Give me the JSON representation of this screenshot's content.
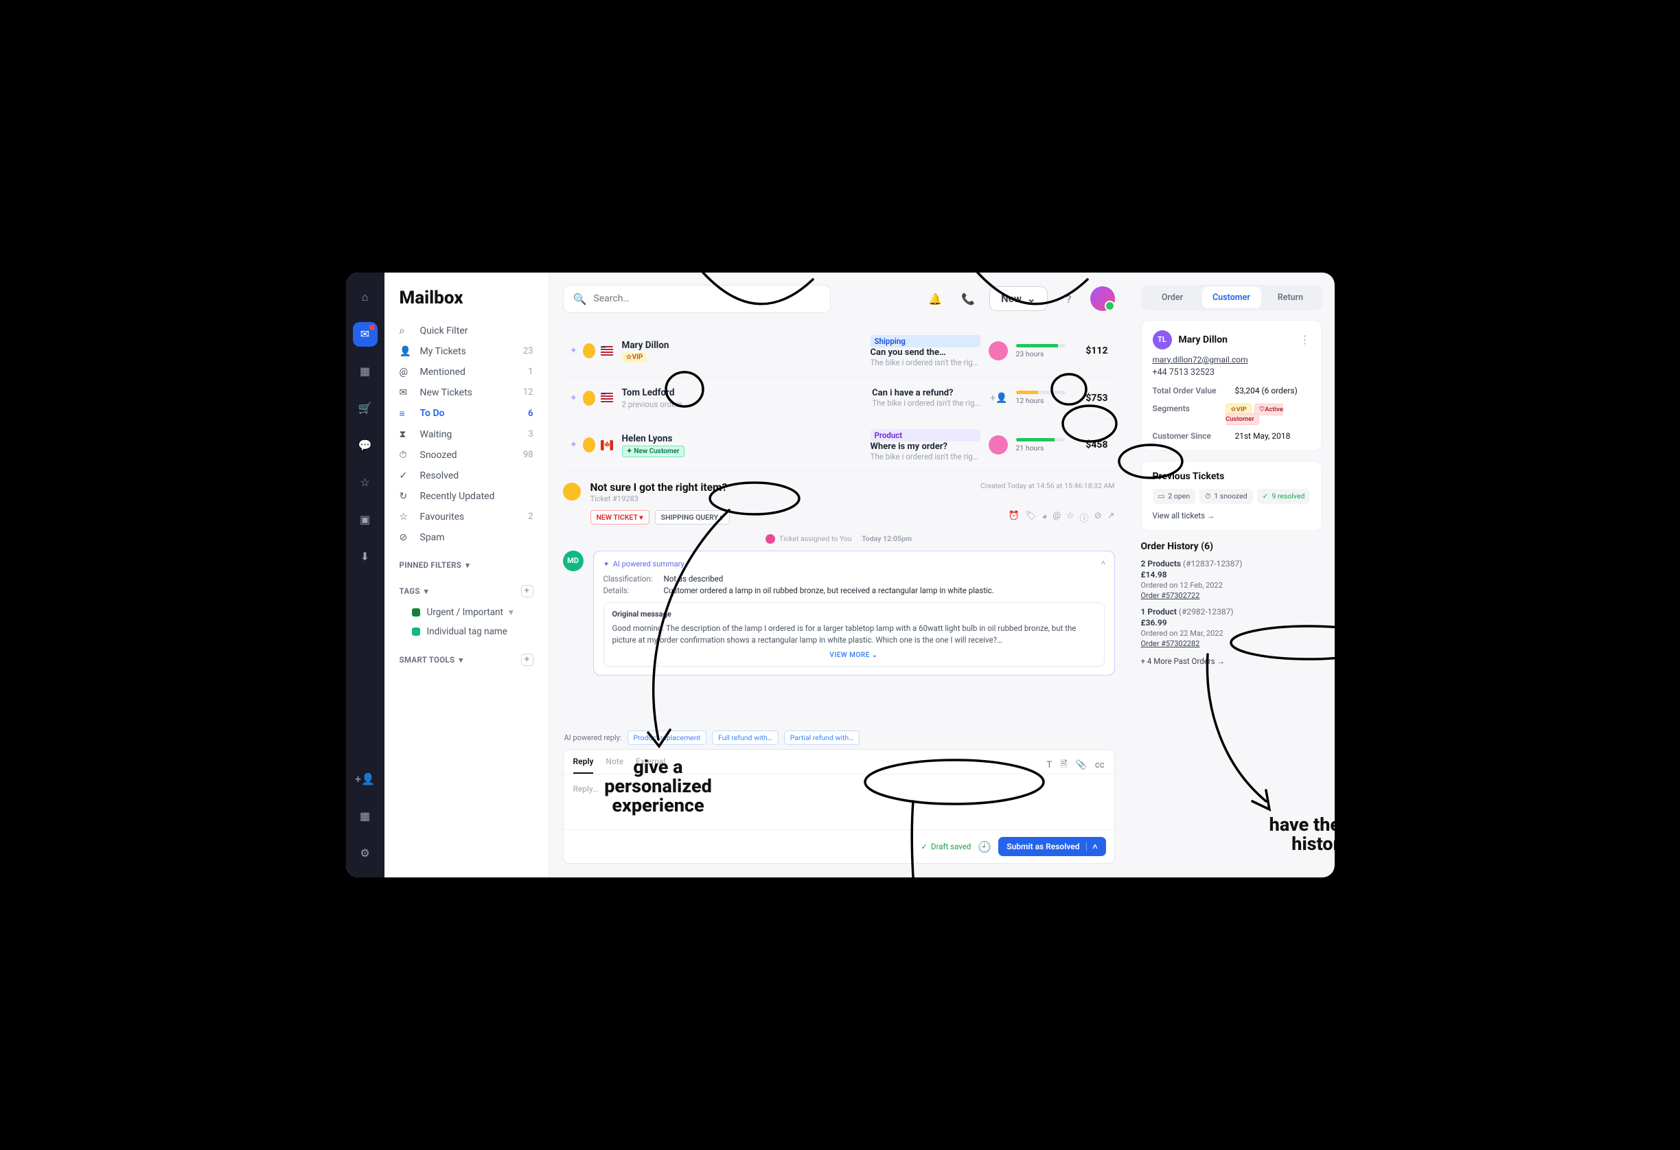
{
  "sidebar": {
    "title": "Mailbox",
    "items": [
      {
        "icon": "filter",
        "label": "Quick Filter",
        "count": ""
      },
      {
        "icon": "person",
        "label": "My Tickets",
        "count": "23"
      },
      {
        "icon": "at",
        "label": "Mentioned",
        "count": "1"
      },
      {
        "icon": "mail",
        "label": "New Tickets",
        "count": "12"
      },
      {
        "icon": "list",
        "label": "To Do",
        "count": "6",
        "active": true
      },
      {
        "icon": "hourglass",
        "label": "Waiting",
        "count": "3"
      },
      {
        "icon": "clock",
        "label": "Snoozed",
        "count": "98"
      },
      {
        "icon": "check",
        "label": "Resolved",
        "count": ""
      },
      {
        "icon": "refresh",
        "label": "Recently Updated",
        "count": ""
      },
      {
        "icon": "star",
        "label": "Favourites",
        "count": "2"
      },
      {
        "icon": "x",
        "label": "Spam",
        "count": ""
      }
    ],
    "sections": {
      "pinned": "PINNED FILTERS",
      "tags": "TAGS",
      "smart": "SMART TOOLS"
    },
    "tags": [
      {
        "color": "#15803d",
        "label": "Urgent / Important"
      },
      {
        "color": "#10b981",
        "label": "Individual tag name"
      }
    ]
  },
  "topbar": {
    "search_placeholder": "Search…",
    "new": "New"
  },
  "tickets": [
    {
      "name": "Mary Dillon",
      "sub_pill": "VIP",
      "subj_pill": "Shipping",
      "subject": "Can you send the…",
      "preview": "The bike i ordered isn't the right…",
      "hours": "23 hours",
      "amount": "$112",
      "bar": 85,
      "bar_color": "green"
    },
    {
      "name": "Tom Ledford",
      "sub_text": "2 previous orders",
      "subject": "Can i have a refund?",
      "preview": "The bike i ordered isn't the rig…",
      "hours": "12 hours",
      "amount": "$753",
      "bar": 45,
      "bar_color": "yellow",
      "add_icon": true
    },
    {
      "name": "Helen Lyons",
      "sub_pill": "New Customer",
      "subj_pill": "Product",
      "subject": "Where is my order?",
      "preview": "The bike i ordered isn't the right s…",
      "hours": "21 hours",
      "amount": "$458",
      "bar": 78,
      "bar_color": "green",
      "flag": "ca"
    }
  ],
  "open": {
    "title": "Not sure I got the right item?",
    "id": "Ticket #19283",
    "created": "Created Today at 14:56 at 15:46:18:32 AM",
    "tags": {
      "new": "NEW TICKET",
      "sq": "SHIPPING QUERY"
    },
    "assigned": {
      "pre": "Ticket assigned to You",
      "when": "Today 12:05pm"
    },
    "avatar": "MD",
    "ai": {
      "head": "AI powered summary",
      "class_k": "Classification:",
      "class_v": "Not as described",
      "det_k": "Details:",
      "det_v": "Customer ordered a lamp in oil rubbed bronze, but received a rectangular lamp in white plastic.",
      "orig_h": "Original message",
      "orig_p": "Good morning. The description of the lamp I ordered is for a larger tabletop lamp with a 60watt light bulb in oil rubbed bronze, but the picture at my order confirmation shows a rectangular lamp in white plastic. Which one is the one I will receive?…",
      "view_more": "VIEW MORE"
    },
    "reply": {
      "label": "AI powered reply:",
      "suggs": [
        "Product replacement",
        "Full refund with…",
        "Partial refund with…"
      ],
      "tabs": [
        "Reply",
        "Note",
        "External"
      ],
      "cc": "cc",
      "placeholder": "Reply…",
      "draft": "Draft saved",
      "submit": "Submit as Resolved"
    }
  },
  "panel": {
    "segs": [
      "Order",
      "Customer",
      "Return"
    ],
    "customer": {
      "init": "TL",
      "name": "Mary Dillon",
      "email": "mary.dillon72@gmail.com",
      "phone": "+44 7513 32523",
      "total_k": "Total Order Value",
      "total_v": "$3,204 (6 orders)",
      "seg_k": "Segments",
      "seg_vip": "☆VIP",
      "seg_act": "♡Active Customer",
      "since_k": "Customer Since",
      "since_v": "21st May, 2018"
    },
    "prev": {
      "head": "Previous Tickets",
      "chips": [
        {
          "ico": "▭",
          "text": "2 open"
        },
        {
          "ico": "⏱",
          "text": "1 snoozed"
        },
        {
          "ico": "✓",
          "text": "9 resolved",
          "done": true
        }
      ],
      "link": "View all tickets →"
    },
    "orders": {
      "head": "Order History (6)",
      "list": [
        {
          "title": "2 Products",
          "oid": "(#12837-12387)",
          "price": "£14.98",
          "date": "Ordered on 12 Feb, 2022",
          "order": "Order #57302722"
        },
        {
          "title": "1 Product",
          "oid": "(#2982-12387)",
          "price": "£36.99",
          "date": "Ordered on 22 Mar, 2022",
          "order": "Order #57302282"
        }
      ],
      "more": "+ 4 More Past Orders →"
    }
  },
  "annotations": {
    "left_1": "give a",
    "left_2": "personalized",
    "left_3": "experience",
    "right_1": "have the full",
    "right_2": "history"
  }
}
